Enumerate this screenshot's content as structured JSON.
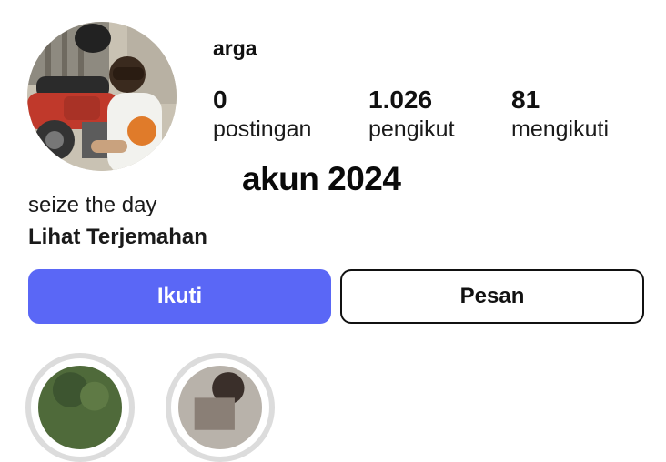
{
  "profile": {
    "username": "arga",
    "bio": "seize the day",
    "translate_link": "Lihat Terjemahan"
  },
  "stats": {
    "posts": {
      "value": "0",
      "label": "postingan"
    },
    "followers": {
      "value": "1.026",
      "label": "pengikut"
    },
    "following": {
      "value": "81",
      "label": "mengikuti"
    }
  },
  "overlay_text": "akun 2024",
  "actions": {
    "follow_label": "Ikuti",
    "message_label": "Pesan"
  },
  "colors": {
    "follow_button": "#5a67f6",
    "highlight_ring": "#dcdcdc"
  }
}
